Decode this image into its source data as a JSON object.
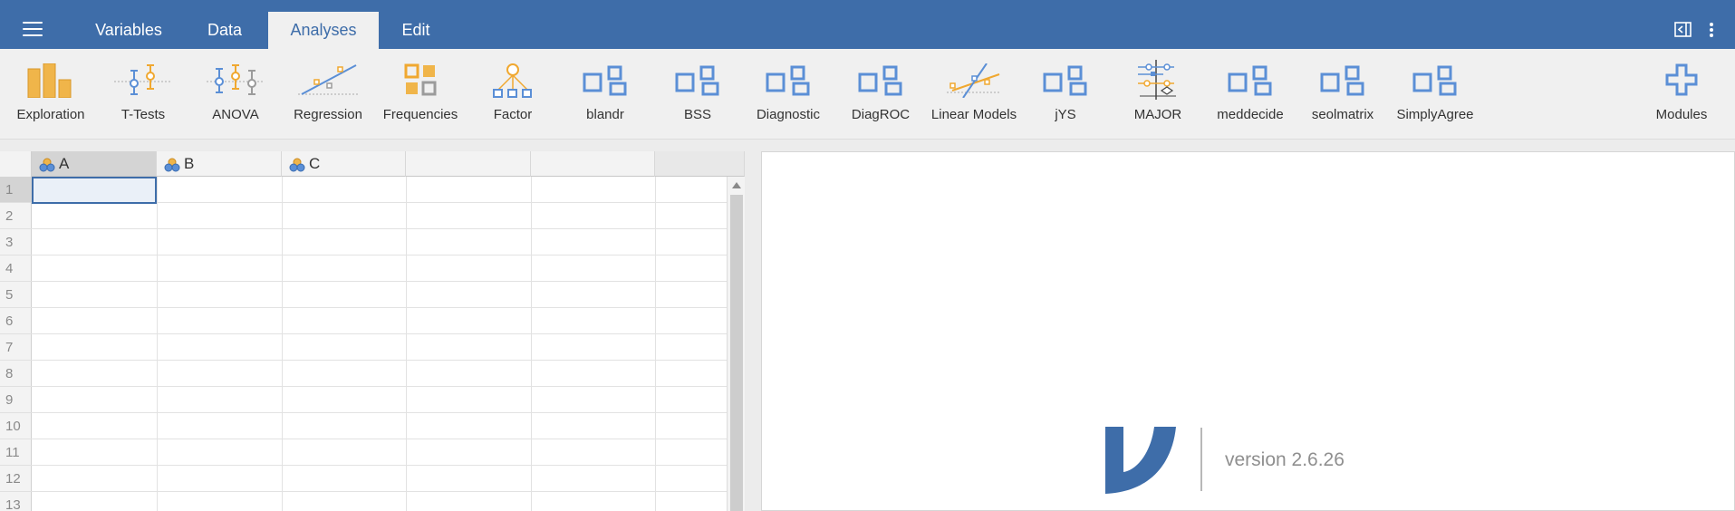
{
  "menu": {
    "tabs": [
      {
        "label": "Variables"
      },
      {
        "label": "Data"
      },
      {
        "label": "Analyses"
      },
      {
        "label": "Edit"
      }
    ],
    "active_tab": "Analyses"
  },
  "ribbon": {
    "items": [
      {
        "label": "Exploration",
        "icon": "exploration-icon"
      },
      {
        "label": "T-Tests",
        "icon": "t-tests-icon"
      },
      {
        "label": "ANOVA",
        "icon": "anova-icon"
      },
      {
        "label": "Regression",
        "icon": "regression-icon"
      },
      {
        "label": "Frequencies",
        "icon": "frequencies-icon"
      },
      {
        "label": "Factor",
        "icon": "factor-icon"
      },
      {
        "label": "blandr",
        "icon": "module-icon"
      },
      {
        "label": "BSS",
        "icon": "module-icon"
      },
      {
        "label": "Diagnostic",
        "icon": "module-icon"
      },
      {
        "label": "DiagROC",
        "icon": "module-icon"
      },
      {
        "label": "Linear Models",
        "icon": "linear-models-icon"
      },
      {
        "label": "jYS",
        "icon": "module-icon"
      },
      {
        "label": "MAJOR",
        "icon": "major-icon"
      },
      {
        "label": "meddecide",
        "icon": "module-icon"
      },
      {
        "label": "seolmatrix",
        "icon": "module-icon"
      },
      {
        "label": "SimplyAgree",
        "icon": "module-icon"
      }
    ],
    "modules_label": "Modules"
  },
  "sheet": {
    "columns": [
      "A",
      "B",
      "C",
      "",
      "",
      ""
    ],
    "rows": [
      "1",
      "2",
      "3",
      "4",
      "5",
      "6",
      "7",
      "8",
      "9",
      "10",
      "11",
      "12",
      "13"
    ]
  },
  "results": {
    "version": "version 2.6.26"
  },
  "colors": {
    "brand_blue": "#3e6da9",
    "accent_orange": "#f0a830",
    "icon_blue": "#5b8fd6"
  }
}
